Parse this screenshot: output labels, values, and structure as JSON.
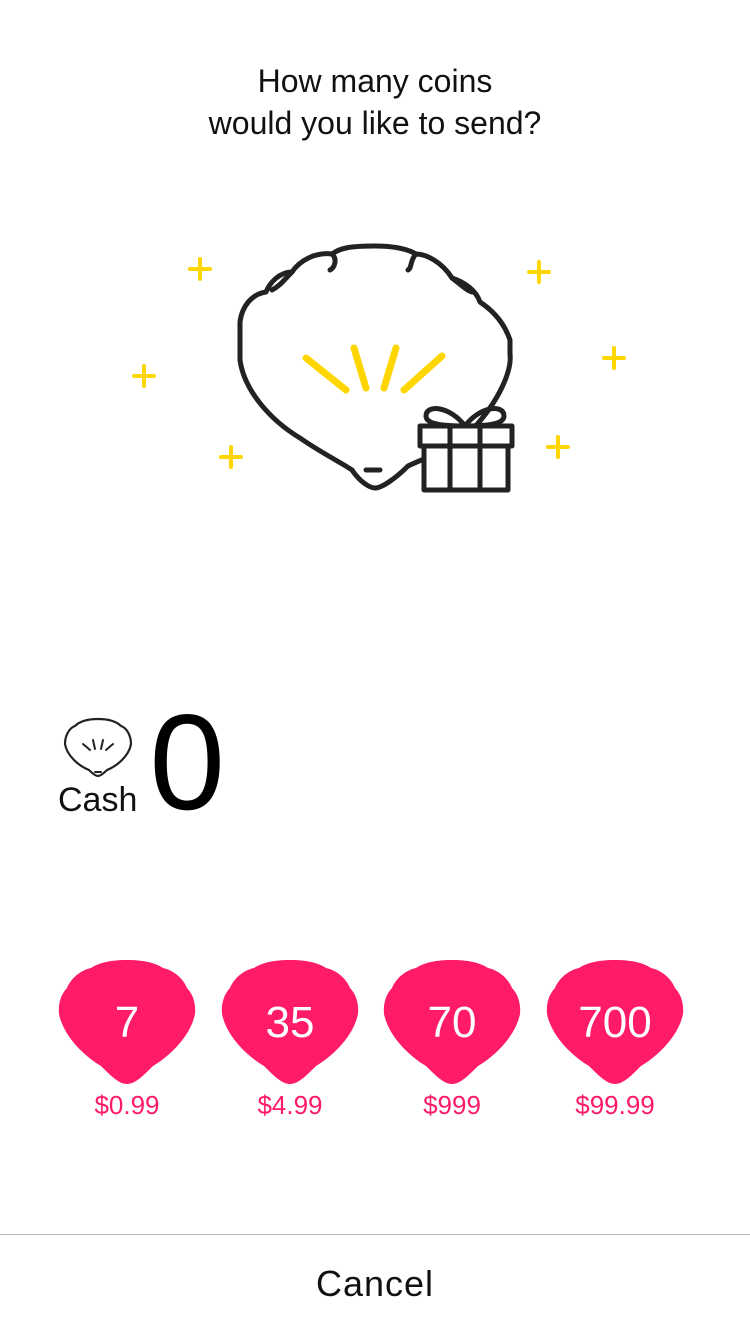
{
  "prompt": {
    "line1": "How many coins",
    "line2": "would you like to send?"
  },
  "hero": {
    "icon": "shell-gift-icon",
    "sparkle_color": "#ffd600",
    "stroke_color": "#222222"
  },
  "balance": {
    "icon": "shell-coin-icon",
    "label": "Cash",
    "value": "0"
  },
  "options": [
    {
      "amount": "7",
      "price": "$0.99"
    },
    {
      "amount": "35",
      "price": "$4.99"
    },
    {
      "amount": "70",
      "price": "$999"
    },
    {
      "amount": "700",
      "price": "$99.99"
    }
  ],
  "accent_color": "#ff1b68",
  "footer": {
    "cancel_label": "Cancel"
  }
}
